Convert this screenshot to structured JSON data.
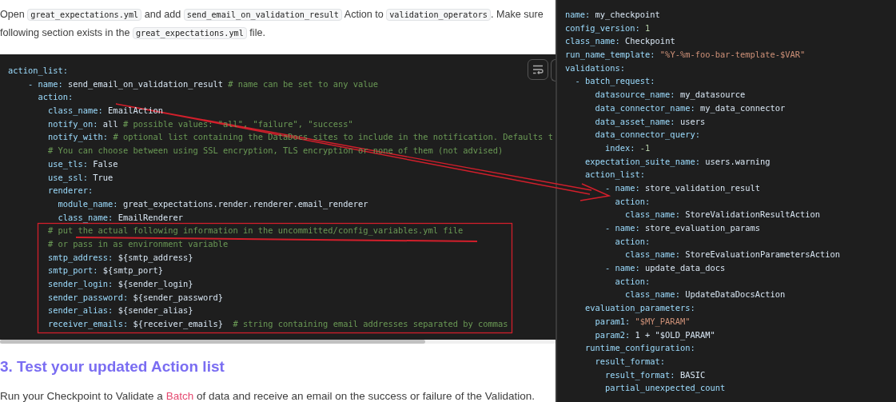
{
  "intro": {
    "lines": [
      [
        {
          "kind": "text",
          "text": "Open "
        },
        {
          "kind": "code",
          "text": "great_expectations.yml"
        },
        {
          "kind": "text",
          "text": " and add "
        },
        {
          "kind": "code",
          "text": "send_email_on_validation_result"
        },
        {
          "kind": "text",
          "text": " Action to "
        },
        {
          "kind": "code",
          "text": "validation_operators"
        },
        {
          "kind": "text",
          "text": ". Make sure"
        }
      ],
      [
        {
          "kind": "text",
          "text": "following section exists in the "
        },
        {
          "kind": "code",
          "text": "great_expectations.yml"
        },
        {
          "kind": "text",
          "text": " file."
        }
      ]
    ]
  },
  "code_block": {
    "lines": [
      [
        {
          "kind": "key",
          "text": "action_list:"
        }
      ],
      [
        {
          "kind": "key",
          "text": "    - name:"
        },
        {
          "kind": "value",
          "text": " send_email_on_validation_result"
        },
        {
          "kind": "comment",
          "text": " # name can be set to any value"
        }
      ],
      [
        {
          "kind": "key",
          "text": "      action:"
        }
      ],
      [
        {
          "kind": "key",
          "text": "        class_name:"
        },
        {
          "kind": "value",
          "text": " EmailAction"
        }
      ],
      [
        {
          "kind": "key",
          "text": "        notify_on:"
        },
        {
          "kind": "value",
          "text": " all"
        },
        {
          "kind": "comment",
          "text": " # possible values: \"all\", \"failure\", \"success\""
        }
      ],
      [
        {
          "kind": "key",
          "text": "        notify_with:"
        },
        {
          "kind": "comment",
          "text": " # optional list containing the DataDocs sites to include in the notification. Defaults t"
        }
      ],
      [
        {
          "kind": "comment",
          "text": "        # You can choose between using SSL encryption, TLS encryption or none of them (not advised)"
        }
      ],
      [
        {
          "kind": "key",
          "text": "        use_tls:"
        },
        {
          "kind": "value",
          "text": " False"
        }
      ],
      [
        {
          "kind": "key",
          "text": "        use_ssl:"
        },
        {
          "kind": "value",
          "text": " True"
        }
      ],
      [
        {
          "kind": "key",
          "text": "        renderer:"
        }
      ],
      [
        {
          "kind": "key",
          "text": "          module_name:"
        },
        {
          "kind": "value",
          "text": " great_expectations.render.renderer.email_renderer"
        }
      ],
      [
        {
          "kind": "key",
          "text": "          class_name:"
        },
        {
          "kind": "value",
          "text": " EmailRenderer"
        }
      ],
      [
        {
          "kind": "comment",
          "text": "        # put the actual following information in the uncommitted/config_variables.yml file"
        }
      ],
      [
        {
          "kind": "comment",
          "text": "        # or pass in as environment variable"
        }
      ],
      [
        {
          "kind": "key",
          "text": "        smtp_address:"
        },
        {
          "kind": "value",
          "text": " ${smtp_address}"
        }
      ],
      [
        {
          "kind": "key",
          "text": "        smtp_port:"
        },
        {
          "kind": "value",
          "text": " ${smtp_port}"
        }
      ],
      [
        {
          "kind": "key",
          "text": "        sender_login:"
        },
        {
          "kind": "value",
          "text": " ${sender_login}"
        }
      ],
      [
        {
          "kind": "key",
          "text": "        sender_password:"
        },
        {
          "kind": "value",
          "text": " ${sender_password}"
        }
      ],
      [
        {
          "kind": "key",
          "text": "        sender_alias:"
        },
        {
          "kind": "value",
          "text": " ${sender_alias}"
        }
      ],
      [
        {
          "kind": "key",
          "text": "        receiver_emails:"
        },
        {
          "kind": "value",
          "text": " ${receiver_emails}"
        },
        {
          "kind": "comment",
          "text": "  # string containing email addresses separated by commas"
        }
      ]
    ]
  },
  "heading": "3. Test your updated Action list",
  "outro": [
    {
      "kind": "text",
      "text": "Run your Checkpoint to Validate a "
    },
    {
      "kind": "link",
      "text": "Batch"
    },
    {
      "kind": "text",
      "text": " of data and receive an email on the success or failure of the Validation."
    }
  ],
  "checkpoint_panel": {
    "lines": [
      [
        {
          "kind": "key",
          "text": "name:"
        },
        {
          "kind": "value",
          "text": " my_checkpoint"
        }
      ],
      [
        {
          "kind": "key",
          "text": "config_version:"
        },
        {
          "kind": "number",
          "text": " 1"
        }
      ],
      [
        {
          "kind": "key",
          "text": "class_name:"
        },
        {
          "kind": "value",
          "text": " Checkpoint"
        }
      ],
      [
        {
          "kind": "key",
          "text": "run_name_template:"
        },
        {
          "kind": "string",
          "text": " \"%Y-%m-foo-bar-template-$VAR\""
        }
      ],
      [
        {
          "kind": "key",
          "text": "validations:"
        }
      ],
      [
        {
          "kind": "key",
          "text": "  - batch_request:"
        }
      ],
      [
        {
          "kind": "key",
          "text": "      datasource_name:"
        },
        {
          "kind": "value",
          "text": " my_datasource"
        }
      ],
      [
        {
          "kind": "key",
          "text": "      data_connector_name:"
        },
        {
          "kind": "value",
          "text": " my_data_connector"
        }
      ],
      [
        {
          "kind": "key",
          "text": "      data_asset_name:"
        },
        {
          "kind": "value",
          "text": " users"
        }
      ],
      [
        {
          "kind": "key",
          "text": "      data_connector_query:"
        }
      ],
      [
        {
          "kind": "key",
          "text": "        index:"
        },
        {
          "kind": "number",
          "text": " -1"
        }
      ],
      [
        {
          "kind": "key",
          "text": "    expectation_suite_name:"
        },
        {
          "kind": "value",
          "text": " users.warning"
        }
      ],
      [
        {
          "kind": "key",
          "text": "    action_list:"
        }
      ],
      [
        {
          "kind": "key",
          "text": "        - name:"
        },
        {
          "kind": "value",
          "text": " store_validation_result"
        }
      ],
      [
        {
          "kind": "key",
          "text": "          action:"
        }
      ],
      [
        {
          "kind": "key",
          "text": "            class_name:"
        },
        {
          "kind": "value",
          "text": " StoreValidationResultAction"
        }
      ],
      [
        {
          "kind": "key",
          "text": "        - name:"
        },
        {
          "kind": "value",
          "text": " store_evaluation_params"
        }
      ],
      [
        {
          "kind": "key",
          "text": "          action:"
        }
      ],
      [
        {
          "kind": "key",
          "text": "            class_name:"
        },
        {
          "kind": "value",
          "text": " StoreEvaluationParametersAction"
        }
      ],
      [
        {
          "kind": "key",
          "text": "        - name:"
        },
        {
          "kind": "value",
          "text": " update_data_docs"
        }
      ],
      [
        {
          "kind": "key",
          "text": "          action:"
        }
      ],
      [
        {
          "kind": "key",
          "text": "            class_name:"
        },
        {
          "kind": "value",
          "text": " UpdateDataDocsAction"
        }
      ],
      [
        {
          "kind": "key",
          "text": "    evaluation_parameters:"
        }
      ],
      [
        {
          "kind": "key",
          "text": "      param1:"
        },
        {
          "kind": "string",
          "text": " \"$MY_PARAM\""
        }
      ],
      [
        {
          "kind": "key",
          "text": "      param2:"
        },
        {
          "kind": "value",
          "text": " 1 + \"$OLD_PARAM\""
        }
      ],
      [
        {
          "kind": "key",
          "text": "    runtime_configuration:"
        }
      ],
      [
        {
          "kind": "key",
          "text": "      result_format:"
        }
      ],
      [
        {
          "kind": "key",
          "text": "        result_format:"
        },
        {
          "kind": "value",
          "text": " BASIC"
        }
      ],
      [
        {
          "kind": "key",
          "text": "        partial_unexpected_count"
        }
      ]
    ]
  }
}
